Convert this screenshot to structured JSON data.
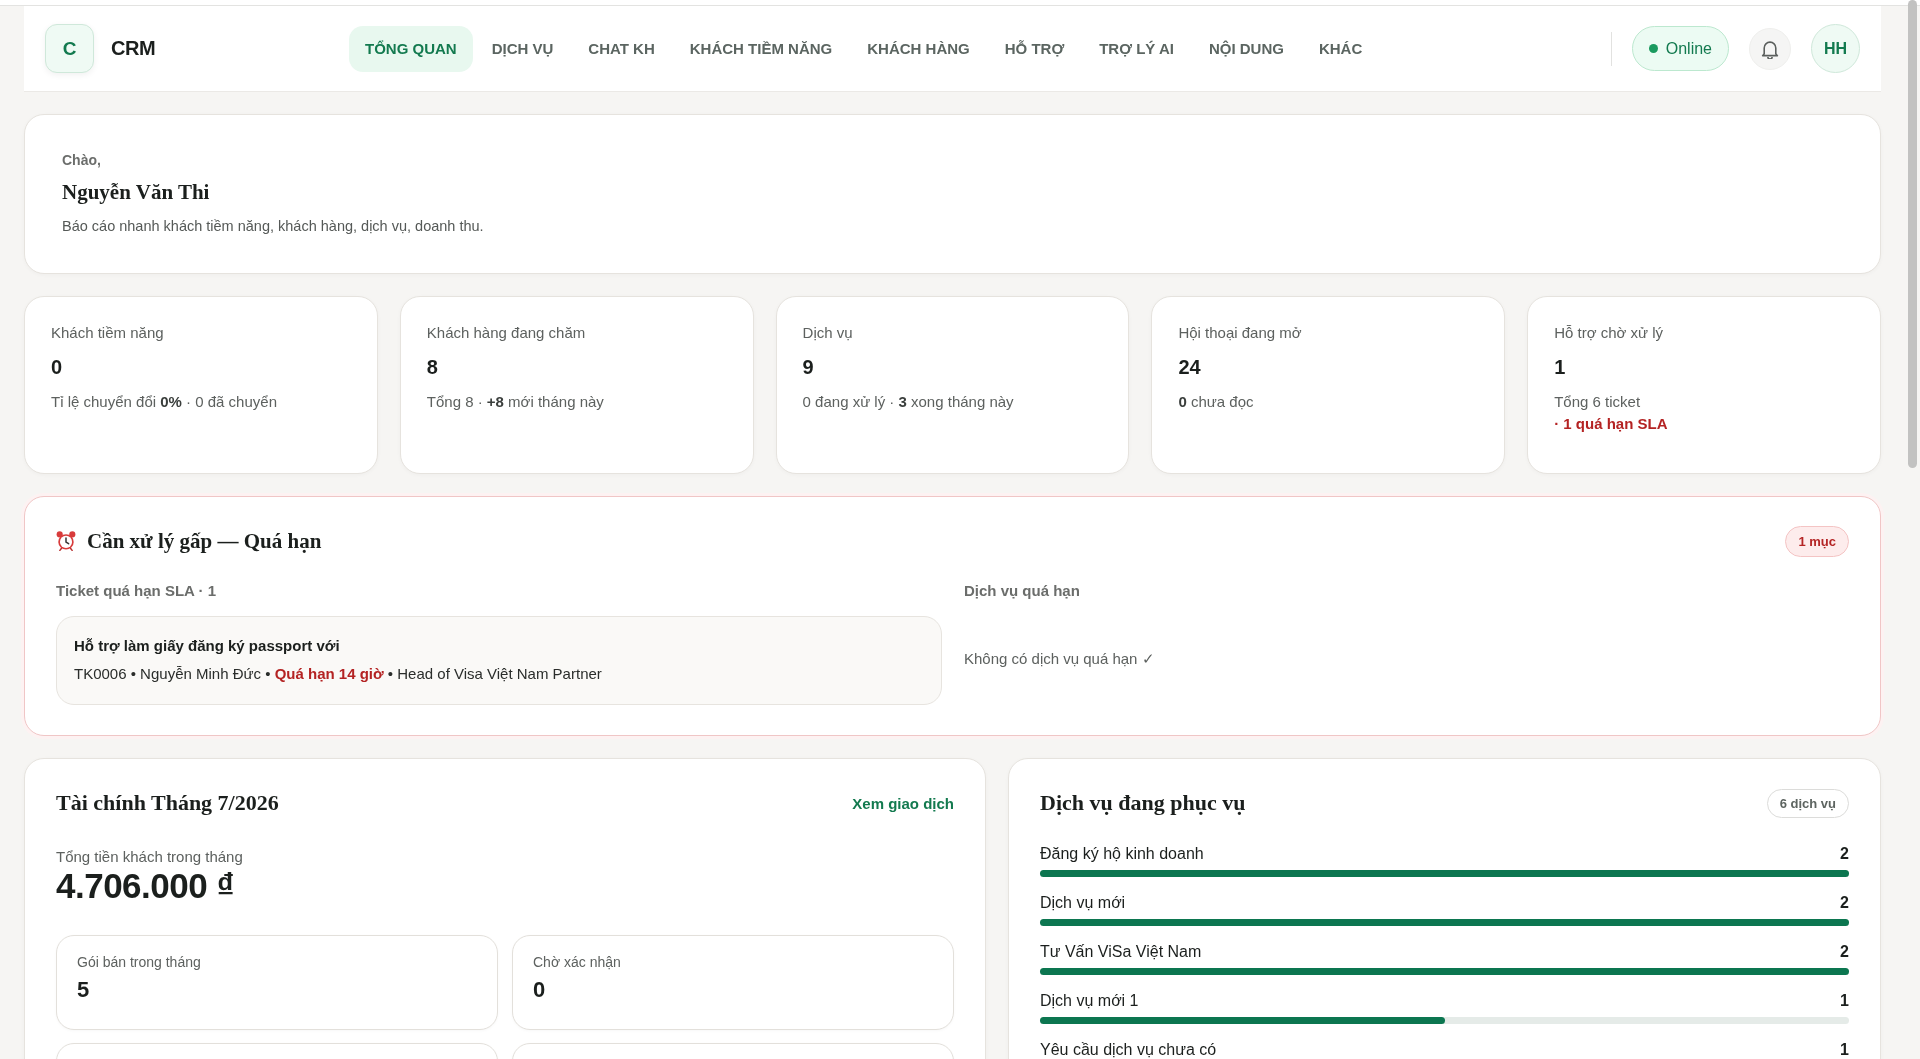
{
  "header": {
    "logo_letter": "C",
    "app_name": "CRM",
    "nav": [
      {
        "label": "TỔNG QUAN",
        "selected": true
      },
      {
        "label": "DỊCH VỤ",
        "selected": false
      },
      {
        "label": "CHAT KH",
        "selected": false
      },
      {
        "label": "KHÁCH TIỀM NĂNG",
        "selected": false
      },
      {
        "label": "KHÁCH HÀNG",
        "selected": false
      },
      {
        "label": "HỖ TRỢ",
        "selected": false
      },
      {
        "label": "TRỢ LÝ AI",
        "selected": false
      },
      {
        "label": "NỘI DUNG",
        "selected": false
      },
      {
        "label": "KHÁC",
        "selected": false
      }
    ],
    "status": {
      "label": "Online",
      "online": true
    },
    "avatar": "HH"
  },
  "greeting": {
    "salutation": "Chào,",
    "name": "Nguyễn Văn Thi",
    "subtitle": "Báo cáo nhanh khách tiềm năng, khách hàng, dịch vụ, doanh thu."
  },
  "stats": [
    {
      "label": "Khách tiềm năng",
      "value": "0",
      "note": "Tỉ lệ chuyển đổi **0%** · 0 đã chuyển"
    },
    {
      "label": "Khách hàng đang chăm",
      "value": "8",
      "note": "Tổng 8 · **+8** mới tháng này"
    },
    {
      "label": "Dịch vụ",
      "value": "9",
      "note": "0 đang xử lý · **3** xong tháng này"
    },
    {
      "label": "Hội thoại đang mở",
      "value": "24",
      "note": "**0** chưa đọc"
    },
    {
      "label": "Hỗ trợ chờ xử lý",
      "value": "1",
      "note": "Tổng 6 ticket",
      "alert": "· 1 quá hạn SLA"
    }
  ],
  "urgent": {
    "title": "Cần xử lý gấp — Quá hạn",
    "badge": "1 mục",
    "tickets": {
      "heading": "Ticket quá hạn SLA · 1",
      "items": [
        {
          "title": "Hỗ trợ làm giấy đăng ký passport với",
          "meta": "TK0006 • Nguyễn Minh Đức • **Quá hạn 14 giờ** • Head of Visa Việt Nam Partner"
        }
      ]
    },
    "services": {
      "heading": "Dịch vụ quá hạn",
      "empty_message": "Không có dịch vụ quá hạn ✓"
    }
  },
  "finance": {
    "title": "Tài chính Tháng 7/2026",
    "link": "Xem giao dịch",
    "total_label": "Tổng tiền khách trong tháng",
    "total": "4.706.000 ₫",
    "cards": [
      {
        "label": "Gói bán trong tháng",
        "value": "5"
      },
      {
        "label": "Chờ xác nhận",
        "value": "0"
      }
    ]
  },
  "services": {
    "title": "Dịch vụ đang phục vụ",
    "badge": "6 dịch vụ",
    "rows": [
      {
        "name": "Đăng ký hộ kinh doanh",
        "count": "2",
        "level": 1
      },
      {
        "name": "Dịch vụ mới",
        "count": "2",
        "level": 1
      },
      {
        "name": "Tư Vấn ViSa Việt Nam",
        "count": "2",
        "level": 1
      },
      {
        "name": "Dịch vụ mới 1",
        "count": "1",
        "level": 0.5
      },
      {
        "name": "Yêu cầu dịch vụ chưa có",
        "count": "1"
      }
    ]
  }
}
